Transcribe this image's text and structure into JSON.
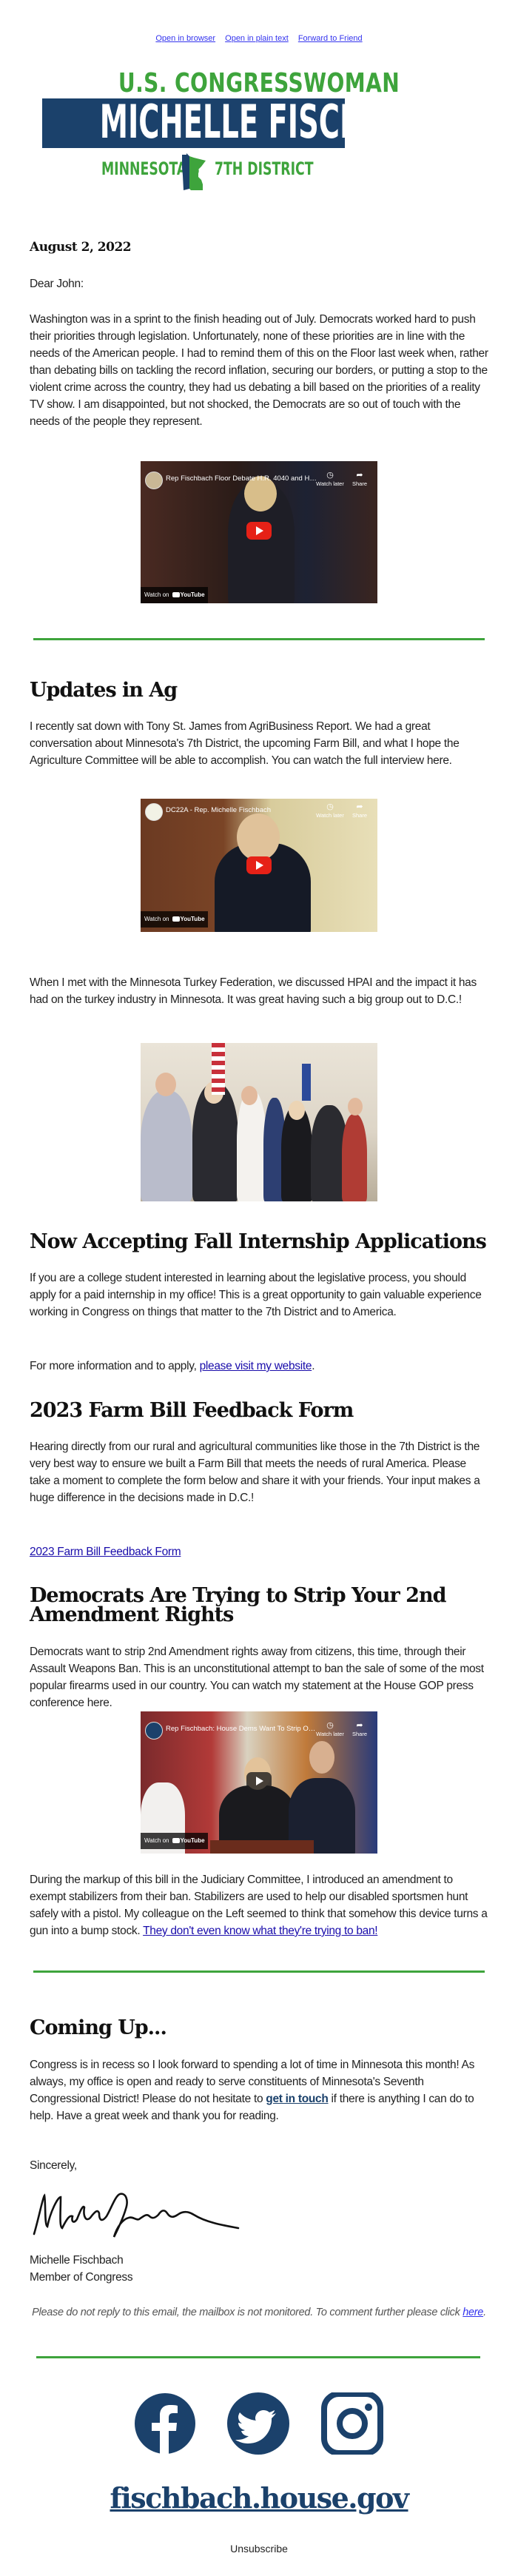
{
  "top_links": [
    "Open in browser",
    "Open in plain text",
    "Forward to Friend"
  ],
  "logo": {
    "line1": "U.S. CONGRESSWOMAN",
    "name": "MICHELLE FISCHBACH",
    "left": "MINNESOTA'S",
    "right": "7TH DISTRICT",
    "colors": {
      "green": "#3ea43c",
      "navy": "#1b416b"
    }
  },
  "letter": {
    "date": "August 2, 2022",
    "greeting": "Dear John:",
    "intro": "Washington was in a sprint to the finish heading out of July. Democrats worked hard to push their priorities through legislation. Unfortunately, none of these priorities are in line with the needs of the American people. I had to remind them of this on the Floor last week when, rather than debating bills on tackling the record inflation, securing our borders, or putting a stop to the violent crime across the country, they had us debating a bill based on the priorities of a reality TV show. I am disappointed, but not shocked, the Democrats are so out of touch with the needs of the people they represent."
  },
  "videos": [
    {
      "title": "Rep Fischbach Floor Debate H.R. 4040 and H.R. 2...",
      "watch_later": "Watch later",
      "share": "Share",
      "watch_on": "Watch on",
      "platform": "YouTube"
    },
    {
      "title": "DC22A - Rep. Michelle Fischbach",
      "watch_later": "Watch later",
      "share": "Share",
      "watch_on": "Watch on",
      "platform": "YouTube"
    },
    {
      "title": "Rep Fischbach: House Dems Want To Strip Our C...",
      "watch_later": "Watch later",
      "share": "Share",
      "watch_on": "Watch on",
      "platform": "YouTube"
    }
  ],
  "sections": {
    "ag": {
      "heading": "Updates in Ag",
      "p1": "I recently sat down with Tony St. James from AgriBusiness Report. We had a great conversation about Minnesota's 7th District, the upcoming Farm Bill, and what I hope the Agriculture Committee will be able to accomplish. You can watch the full interview here.",
      "p2": "When I met with the Minnesota Turkey Federation, we discussed HPAI and the impact it has had on the turkey industry in Minnesota. It was great having such a big group out to D.C.!"
    },
    "internship": {
      "heading": "Now Accepting Fall Internship Applications",
      "p1": "If you are a college student interested in learning about the legislative process, you should apply for a paid internship in my office! This is a great opportunity to gain valuable experience working in Congress on things that matter to the 7th District and to America.",
      "p2_prefix": "For more information and to apply, ",
      "p2_link": "please visit my website",
      "p2_suffix": "."
    },
    "farm_bill": {
      "heading": "2023 Farm Bill Feedback Form",
      "p1": "Hearing directly from our rural and agricultural communities like those in the 7th District is the very best way to ensure we built a Farm Bill that meets the needs of rural America. Please take a moment to complete the form below and share it with your friends. Your input makes a huge difference in the decisions made in D.C.!",
      "link": "2023 Farm Bill Feedback Form"
    },
    "second_amendment": {
      "heading": "Democrats Are Trying to Strip Your 2nd Amendment Rights",
      "p1": "Democrats want to strip 2nd Amendment rights away from citizens, this time, through their Assault Weapons Ban. This is an unconstitutional attempt to ban the sale of some of the most popular firearms used in our country. You can watch my statement at the House GOP press conference here.",
      "p2_prefix": "During the markup of this bill in the Judiciary Committee, I introduced an amendment to exempt stabilizers from their ban. Stabilizers are used to help our disabled sportsmen hunt safely with a pistol. My colleague on the Left seemed to think that somehow this device turns a gun into a bump stock. ",
      "p2_link": "They don't even know what they're trying to ban!"
    },
    "coming_up": {
      "heading": "Coming Up...",
      "p1_prefix": "Congress is in recess so I look forward to spending a lot of time in Minnesota this month! As always, my office is open and ready to serve constituents of Minnesota's Seventh Congressional District! Please do not hesitate to ",
      "p1_link": "get in touch",
      "p1_suffix": " if there is anything I can do to help. Have a great week and thank you for reading."
    }
  },
  "signoff": {
    "closing": "Sincerely,",
    "name": "Michelle Fischbach",
    "title": "Member of  Congress"
  },
  "footer": {
    "note_prefix": "Please do not reply to this email, the mailbox is not monitored.  To comment further please click ",
    "note_link": "here",
    "note_suffix": ".",
    "social": [
      "facebook",
      "twitter",
      "instagram"
    ],
    "website": "fischbach.house.gov",
    "unsubscribe": "Unsubscribe"
  }
}
